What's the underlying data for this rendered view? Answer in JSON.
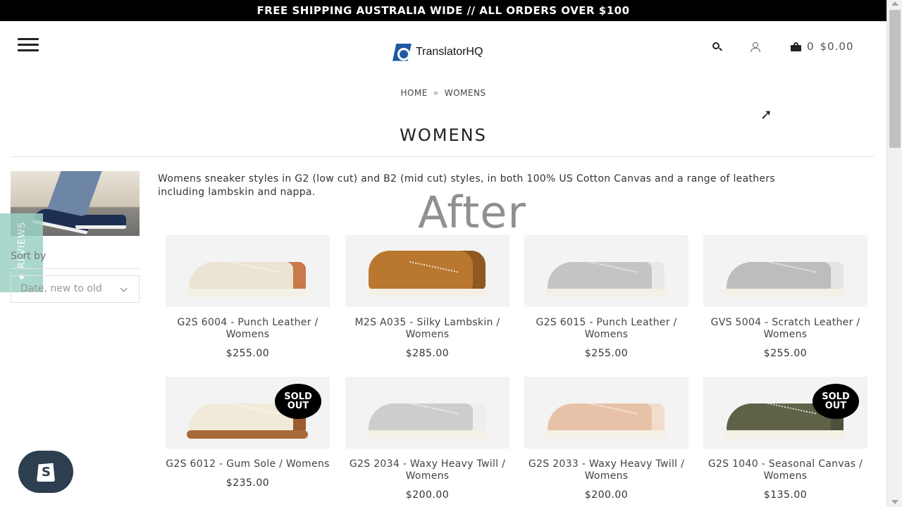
{
  "announcement": "FREE SHIPPING AUSTRALIA WIDE // ALL ORDERS OVER $100",
  "header": {
    "logo_text": "TranslatorHQ",
    "cart_count": "0",
    "cart_total": "$0.00"
  },
  "breadcrumb": {
    "home": "HOME",
    "separator": "»",
    "current": "WOMENS"
  },
  "page_title": "WOMENS",
  "collection_description": "Womens sneaker styles in G2 (low cut) and B2 (mid cut) styles, in both 100% US Cotton Canvas and a range of leathers including lambskin and nappa.",
  "watermark": "After",
  "reviews_tab": "★ REVIEWS",
  "sort": {
    "label": "Sort by",
    "selected": "Date, new to old"
  },
  "badge_label": "SOLD OUT",
  "products": [
    {
      "name": "G2S 6004 - Punch Leather / Womens",
      "price": "$255.00",
      "sold_out": false,
      "color": "#ebe3d4",
      "accent": "#c9794a"
    },
    {
      "name": "M2S A035 - Silky Lambskin / Womens",
      "price": "$285.00",
      "sold_out": false,
      "color": "#b9772f",
      "accent": "#8f5a20"
    },
    {
      "name": "G2S 6015 - Punch Leather / Womens",
      "price": "$255.00",
      "sold_out": false,
      "color": "#c4c4c4",
      "accent": "#e8e8e8"
    },
    {
      "name": "GVS 5004 - Scratch Leather / Womens",
      "price": "$255.00",
      "sold_out": false,
      "color": "#bdbdbd",
      "accent": "#e4e4e4"
    },
    {
      "name": "G2S 6012 - Gum Sole / Womens",
      "price": "$235.00",
      "sold_out": true,
      "color": "#f1ead9",
      "accent": "#9b5b2e"
    },
    {
      "name": "G2S 2034 - Waxy Heavy Twill / Womens",
      "price": "$200.00",
      "sold_out": false,
      "color": "#cdcdcd",
      "accent": "#eeeeee"
    },
    {
      "name": "G2S 2033 - Waxy Heavy Twill / Womens",
      "price": "$200.00",
      "sold_out": false,
      "color": "#e8c2a8",
      "accent": "#f3dccb"
    },
    {
      "name": "G2S 1040 - Seasonal Canvas / Womens",
      "price": "$135.00",
      "sold_out": true,
      "color": "#5f6246",
      "accent": "#4d5039"
    }
  ]
}
